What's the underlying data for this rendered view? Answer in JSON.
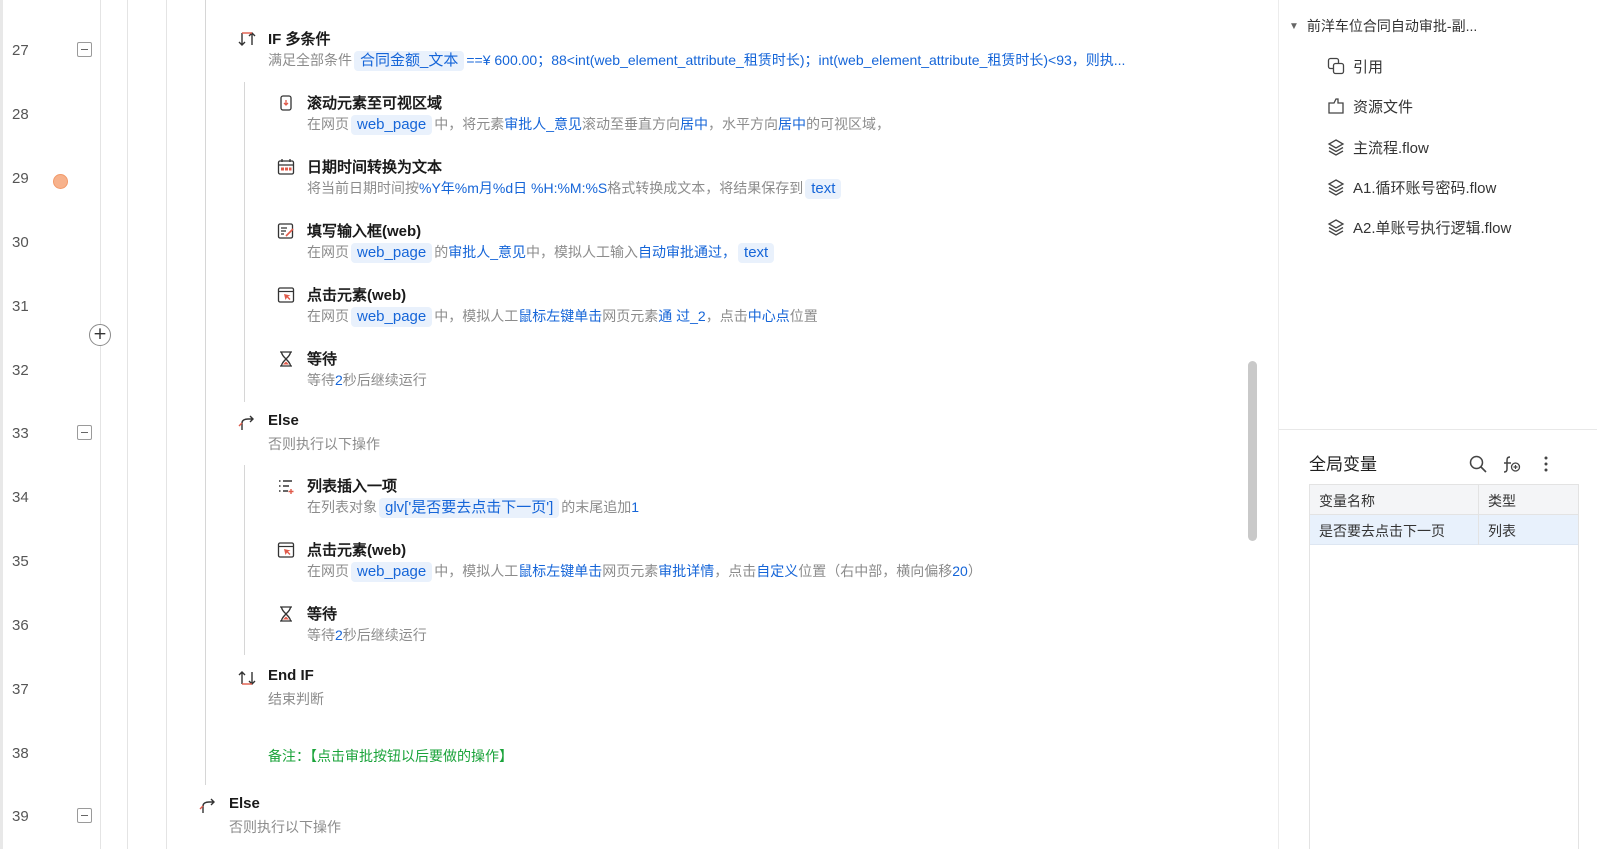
{
  "editor": {
    "line_numbers": [
      "27",
      "28",
      "29",
      "30",
      "31",
      "32",
      "33",
      "34",
      "35",
      "36",
      "37",
      "38",
      "39"
    ],
    "steps": {
      "if_multi": {
        "title": "IF 多条件",
        "desc_prefix": "满足全部条件",
        "tag": "合同金额_文本",
        "desc_rest": "==¥ 600.00；88<int(web_element_attribute_租赁时长)；int(web_element_attribute_租赁时长)<93，则执..."
      },
      "scroll": {
        "title": "滚动元素至可视区域",
        "p1": "在网页",
        "tag": "web_page",
        "p2": "中，将元素",
        "h1": "审批人_意见",
        "p3": "滚动至垂直方向",
        "h2": "居中",
        "p4": "，水平方向",
        "h3": "居中",
        "p5": "的可视区域，"
      },
      "datetime": {
        "title": "日期时间转换为文本",
        "p1": "将当前日期时间按",
        "h1": "%Y年%m月%d日 %H:%M:%S",
        "p2": "格式转换成文本，将结果保存到",
        "tag": "text"
      },
      "fill_input": {
        "title": "填写输入框(web)",
        "p1": "在网页",
        "tag": "web_page",
        "p2": "的",
        "h1": "审批人_意见",
        "p3": "中，模拟人工输入",
        "h2": "自动审批通过，",
        "tag2": "text"
      },
      "click1": {
        "title": "点击元素(web)",
        "p1": "在网页",
        "tag": "web_page",
        "p2": "中，模拟人工",
        "h1": "鼠标左键单击",
        "p3": "网页元素",
        "h2": "通 过_2",
        "p4": "，点击",
        "h3": "中心点",
        "p5": "位置"
      },
      "wait1": {
        "title": "等待",
        "p1": "等待",
        "h1": "2",
        "p2": "秒后继续运行"
      },
      "else1": {
        "title": "Else",
        "desc": "否则执行以下操作"
      },
      "list_insert": {
        "title": "列表插入一项",
        "p1": "在列表对象",
        "tag": "glv['是否要去点击下一页']",
        "p2": "的末尾追加",
        "h1": "1"
      },
      "click2": {
        "title": "点击元素(web)",
        "p1": "在网页",
        "tag": "web_page",
        "p2": "中，模拟人工",
        "h1": "鼠标左键单击",
        "p3": "网页元素",
        "h2": "审批详情",
        "p4": "，点击",
        "h3": "自定义",
        "p5": "位置（右中部，横向偏移",
        "h4": "20",
        "p6": "）"
      },
      "wait2": {
        "title": "等待",
        "p1": "等待",
        "h1": "2",
        "p2": "秒后继续运行"
      },
      "endif": {
        "title": "End IF",
        "desc": "结束判断"
      },
      "note": {
        "text": "备注：【点击审批按钮以后要做的操作】"
      },
      "else2": {
        "title": "Else",
        "desc": "否则执行以下操作"
      }
    }
  },
  "sidebar": {
    "project_title": "前洋车位合同自动审批-副...",
    "items": [
      {
        "label": "引用",
        "icon": "copy-icon"
      },
      {
        "label": "资源文件",
        "icon": "resource-icon"
      },
      {
        "label": "主流程.flow",
        "icon": "layers-icon"
      },
      {
        "label": "A1.循环账号密码.flow",
        "icon": "layers-icon"
      },
      {
        "label": "A2.单账号执行逻辑.flow",
        "icon": "layers-icon"
      }
    ]
  },
  "globals": {
    "title": "全局变量",
    "columns": [
      "变量名称",
      "类型"
    ],
    "rows": [
      {
        "name": "是否要去点击下一页",
        "type": "列表"
      }
    ]
  },
  "colors": {
    "link": "#1565d8",
    "note": "#1aa33a",
    "breakpoint": "#f7b28c",
    "selected_row": "#e8f1fc"
  }
}
